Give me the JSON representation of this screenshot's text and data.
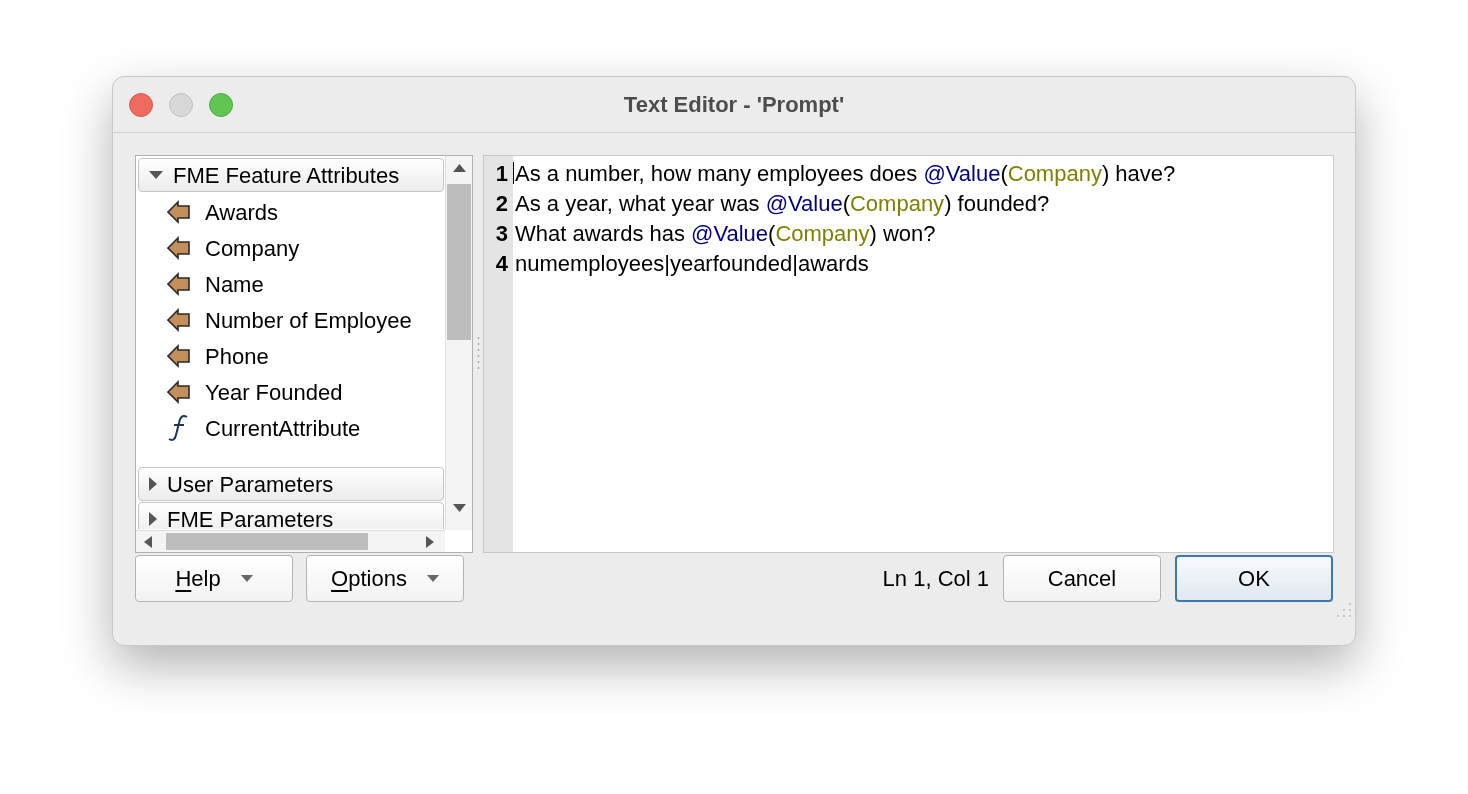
{
  "window": {
    "title": "Text Editor - 'Prompt'"
  },
  "tree": {
    "sections": [
      {
        "label": "FME Feature Attributes",
        "expanded": true,
        "children": [
          {
            "label": "Awards",
            "kind": "attribute"
          },
          {
            "label": "Company",
            "kind": "attribute"
          },
          {
            "label": "Name",
            "kind": "attribute"
          },
          {
            "label": "Number of Employee",
            "kind": "attribute"
          },
          {
            "label": "Phone",
            "kind": "attribute"
          },
          {
            "label": "Year Founded",
            "kind": "attribute"
          },
          {
            "label": "CurrentAttribute",
            "kind": "function"
          }
        ]
      },
      {
        "label": "User Parameters",
        "expanded": false
      },
      {
        "label": "FME Parameters",
        "expanded": false
      }
    ]
  },
  "editor": {
    "lines": [
      {
        "number": "1",
        "segments": [
          {
            "kind": "text",
            "text": "As a number, how many employees does "
          },
          {
            "kind": "function",
            "text": "@Value"
          },
          {
            "kind": "text",
            "text": "("
          },
          {
            "kind": "argument",
            "text": "Company"
          },
          {
            "kind": "text",
            "text": ") have?"
          }
        ]
      },
      {
        "number": "2",
        "segments": [
          {
            "kind": "text",
            "text": "As a year, what year was "
          },
          {
            "kind": "function",
            "text": "@Value"
          },
          {
            "kind": "text",
            "text": "("
          },
          {
            "kind": "argument",
            "text": "Company"
          },
          {
            "kind": "text",
            "text": ") founded?"
          }
        ]
      },
      {
        "number": "3",
        "segments": [
          {
            "kind": "text",
            "text": "What awards has "
          },
          {
            "kind": "function",
            "text": "@Value"
          },
          {
            "kind": "text",
            "text": "("
          },
          {
            "kind": "argument",
            "text": "Company"
          },
          {
            "kind": "text",
            "text": ") won?"
          }
        ]
      },
      {
        "number": "4",
        "segments": [
          {
            "kind": "text",
            "text": "numemployees|yearfounded|awards"
          }
        ]
      }
    ]
  },
  "menu_buttons": [
    {
      "label": "Help",
      "mnemonic_underlined": true
    },
    {
      "label": "Options",
      "mnemonic_underlined": true
    }
  ],
  "cursor_position": "Ln 1, Col 1",
  "buttons": [
    {
      "label": "Cancel",
      "default": false
    },
    {
      "label": "OK",
      "default": true
    }
  ]
}
